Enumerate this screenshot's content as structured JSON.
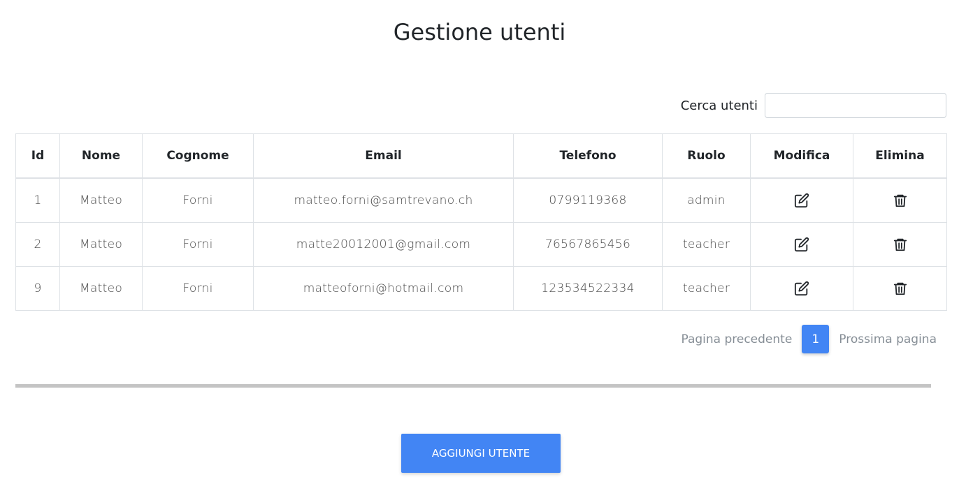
{
  "page": {
    "title": "Gestione utenti"
  },
  "search": {
    "label": "Cerca utenti",
    "value": "",
    "placeholder": ""
  },
  "table": {
    "headers": [
      "Id",
      "Nome",
      "Cognome",
      "Email",
      "Telefono",
      "Ruolo",
      "Modifica",
      "Elimina"
    ],
    "rows": [
      {
        "id": "1",
        "nome": "Matteo",
        "cognome": "Forni",
        "email": "matteo.forni@samtrevano.ch",
        "telefono": "0799119368",
        "ruolo": "admin",
        "modifica_icon": "edit-icon",
        "elimina_icon": "trash-icon"
      },
      {
        "id": "2",
        "nome": "Matteo",
        "cognome": "Forni",
        "email": "matte20012001@gmail.com",
        "telefono": "76567865456",
        "ruolo": "teacher",
        "modifica_icon": "edit-icon",
        "elimina_icon": "trash-icon"
      },
      {
        "id": "9",
        "nome": "Matteo",
        "cognome": "Forni",
        "email": "matteoforni@hotmail.com",
        "telefono": "123534522334",
        "ruolo": "teacher",
        "modifica_icon": "edit-icon",
        "elimina_icon": "trash-icon"
      }
    ]
  },
  "pagination": {
    "prev_label": "Pagina precedente",
    "current_page": "1",
    "next_label": "Prossima pagina"
  },
  "actions": {
    "add_user_label": "AGGIUNGI UTENTE"
  },
  "colors": {
    "accent": "#4285f4",
    "divider": "#c4c4c4",
    "border": "#dee2e6",
    "muted_text": "#868e96"
  }
}
